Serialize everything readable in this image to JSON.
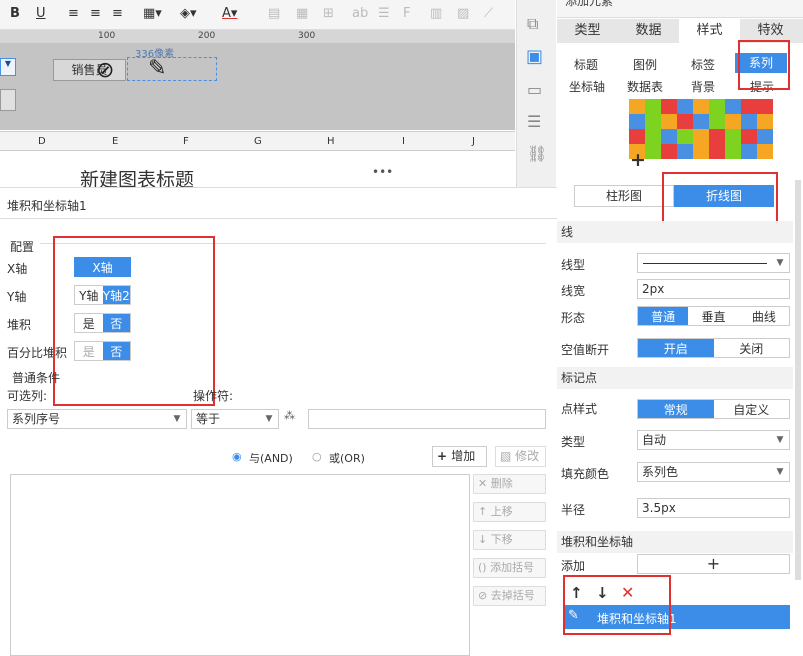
{
  "toolbar": {
    "underline": "U"
  },
  "sheet": {
    "ruler_ticks": [
      "100",
      "200",
      "300"
    ],
    "cell_label": "销售员",
    "size_hint": "336像素",
    "columns": [
      "D",
      "E",
      "F",
      "G",
      "H",
      "I",
      "J"
    ],
    "chart_title": "新建图表标题",
    "more": "•••"
  },
  "dialog": {
    "title": "堆积和坐标轴1",
    "config_label": "配置",
    "xaxis_label": "X轴",
    "xaxis_option": "X轴",
    "yaxis_label": "Y轴",
    "yaxis_options": [
      "Y轴",
      "Y轴2"
    ],
    "stack_label": "堆积",
    "stack_options": [
      "是",
      "否"
    ],
    "percent_label": "百分比堆积",
    "percent_options": [
      "是",
      "否"
    ],
    "condition_label": "普通条件",
    "column_label": "可选列:",
    "operator_label": "操作符:",
    "column_value": "系列序号",
    "operator_value": "等于",
    "and_label": "与(AND)",
    "or_label": "或(OR)",
    "add_label": "增加",
    "modify_label": "修改",
    "delete_label": "删除",
    "up_label": "上移",
    "down_label": "下移",
    "add_bracket": "添加括号",
    "remove_bracket": "去掉括号"
  },
  "rpanel": {
    "top_label": "添加元素",
    "tabs": [
      "类型",
      "数据",
      "样式",
      "特效"
    ],
    "subtabs": [
      "标题",
      "图例",
      "标签",
      "系列",
      "坐标轴",
      "数据表",
      "背景",
      "提示"
    ],
    "palette": [
      "#f5a623",
      "#7ed321",
      "#e83e3e",
      "#4a90e2",
      "#f5a623",
      "#7ed321",
      "#4a90e2",
      "#e83e3e",
      "#e83e3e",
      "#4a90e2",
      "#7ed321",
      "#f5a623",
      "#e83e3e",
      "#4a90e2",
      "#7ed321",
      "#f5a623",
      "#4a90e2",
      "#f5a623",
      "#e83e3e",
      "#7ed321",
      "#4a90e2",
      "#7ed321",
      "#f5a623",
      "#e83e3e",
      "#7ed321",
      "#e83e3e",
      "#4a90e2",
      "#f5a623",
      "#7ed321",
      "#e83e3e",
      "#4a90e2",
      "#f5a623",
      "#e83e3e",
      "#7ed321",
      "#4a90e2",
      "#f5a623"
    ],
    "plus": "+",
    "chart_types": [
      "柱形图",
      "折线图"
    ],
    "line_section": "线",
    "line_type_label": "线型",
    "line_width_label": "线宽",
    "line_width_value": "2px",
    "shape_label": "形态",
    "shape_options": [
      "普通",
      "垂直",
      "曲线"
    ],
    "null_label": "空值断开",
    "null_options": [
      "开启",
      "关闭"
    ],
    "marker_section": "标记点",
    "marker_style_label": "点样式",
    "marker_style_options": [
      "常规",
      "自定义"
    ],
    "type_label": "类型",
    "type_value": "自动",
    "fill_label": "填充颜色",
    "fill_value": "系列色",
    "radius_label": "半径",
    "radius_value": "3.5px",
    "stack_section": "堆积和坐标轴",
    "add_label": "添加",
    "add_plus": "+",
    "list_item": "堆积和坐标轴1"
  }
}
